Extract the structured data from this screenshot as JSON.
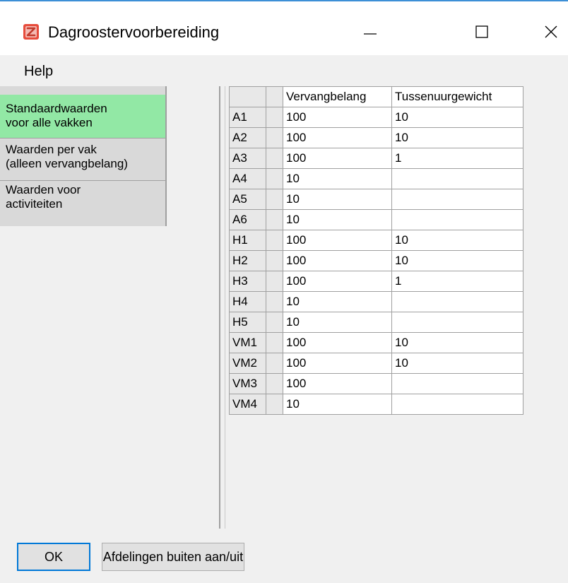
{
  "window": {
    "title": "Dagroostervoorbereiding",
    "controls": {
      "minimize": "—",
      "maximize": "☐",
      "close": "✕"
    },
    "accent_color": "#3c8fd6"
  },
  "menu": {
    "help": "Help"
  },
  "categories": [
    {
      "line1": "Standaardwaarden",
      "line2": "voor alle vakken",
      "selected": true,
      "color": "#92e8a5"
    },
    {
      "line1": "Waarden per vak",
      "line2": "(alleen vervangbelang)",
      "selected": false
    },
    {
      "line1": "Waarden voor",
      "line2": "activiteiten",
      "selected": false
    }
  ],
  "table": {
    "columns": [
      "",
      "",
      "Vervangbelang",
      "Tussenuurgewicht"
    ],
    "rows": [
      {
        "name": "A1",
        "vervangbelang": "100",
        "tussenuurgewicht": "10"
      },
      {
        "name": "A2",
        "vervangbelang": "100",
        "tussenuurgewicht": "10"
      },
      {
        "name": "A3",
        "vervangbelang": "100",
        "tussenuurgewicht": "1"
      },
      {
        "name": "A4",
        "vervangbelang": "10",
        "tussenuurgewicht": ""
      },
      {
        "name": "A5",
        "vervangbelang": "10",
        "tussenuurgewicht": ""
      },
      {
        "name": "A6",
        "vervangbelang": "10",
        "tussenuurgewicht": ""
      },
      {
        "name": "H1",
        "vervangbelang": "100",
        "tussenuurgewicht": "10"
      },
      {
        "name": "H2",
        "vervangbelang": "100",
        "tussenuurgewicht": "10"
      },
      {
        "name": "H3",
        "vervangbelang": "100",
        "tussenuurgewicht": "1"
      },
      {
        "name": "H4",
        "vervangbelang": "10",
        "tussenuurgewicht": ""
      },
      {
        "name": "H5",
        "vervangbelang": "10",
        "tussenuurgewicht": ""
      },
      {
        "name": "VM1",
        "vervangbelang": "100",
        "tussenuurgewicht": "10"
      },
      {
        "name": "VM2",
        "vervangbelang": "100",
        "tussenuurgewicht": "10"
      },
      {
        "name": "VM3",
        "vervangbelang": "100",
        "tussenuurgewicht": ""
      },
      {
        "name": "VM4",
        "vervangbelang": "10",
        "tussenuurgewicht": ""
      }
    ]
  },
  "buttons": {
    "ok": "OK",
    "afdelingen": "Afdelingen buiten aan/uit"
  }
}
